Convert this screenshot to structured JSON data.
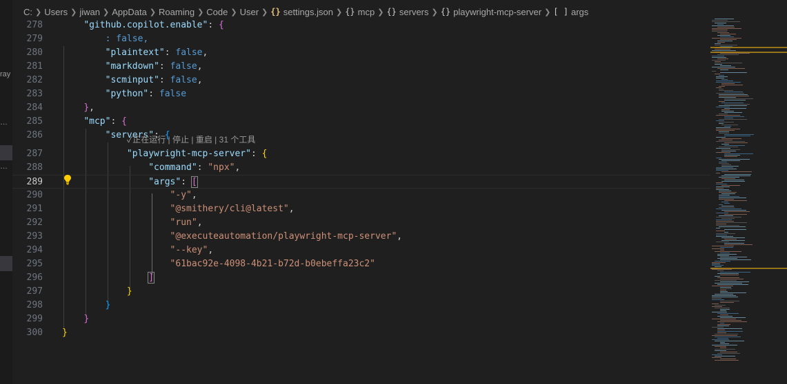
{
  "breadcrumb": {
    "items": [
      {
        "label": "C:",
        "icon": ""
      },
      {
        "label": "Users",
        "icon": ""
      },
      {
        "label": "jiwan",
        "icon": ""
      },
      {
        "label": "AppData",
        "icon": ""
      },
      {
        "label": "Roaming",
        "icon": ""
      },
      {
        "label": "Code",
        "icon": ""
      },
      {
        "label": "User",
        "icon": ""
      },
      {
        "label": "settings.json",
        "icon": "json-braces-icon"
      },
      {
        "label": "mcp",
        "icon": "object-braces-icon"
      },
      {
        "label": "servers",
        "icon": "object-braces-icon"
      },
      {
        "label": "playwright-mcp-server",
        "icon": "object-braces-icon"
      },
      {
        "label": "args",
        "icon": "array-brackets-icon"
      }
    ]
  },
  "sidebar_fragments": [
    "ray",
    "…",
    "…"
  ],
  "editor": {
    "active_line": "289",
    "lines": [
      {
        "n": "278",
        "html": "    <span class=\"k\">\"github.copilot.enable\"</span><span class=\"p\">: </span><span class=\"br2\">{</span>"
      },
      {
        "n": "279",
        "html": "        <span class=\"b\">: false,</span>"
      },
      {
        "n": "280",
        "html": "        <span class=\"k\">\"plaintext\"</span><span class=\"p\">: </span><span class=\"b\">false</span><span class=\"p\">,</span>"
      },
      {
        "n": "281",
        "html": "        <span class=\"k\">\"markdown\"</span><span class=\"p\">: </span><span class=\"b\">false</span><span class=\"p\">,</span>"
      },
      {
        "n": "282",
        "html": "        <span class=\"k\">\"scminput\"</span><span class=\"p\">: </span><span class=\"b\">false</span><span class=\"p\">,</span>"
      },
      {
        "n": "283",
        "html": "        <span class=\"k\">\"python\"</span><span class=\"p\">: </span><span class=\"b\">false</span>"
      },
      {
        "n": "284",
        "html": "    <span class=\"br2\">}</span><span class=\"p\">,</span>"
      },
      {
        "n": "285",
        "html": "    <span class=\"k\">\"mcp\"</span><span class=\"p\">: </span><span class=\"br2\">{</span>"
      },
      {
        "n": "286",
        "html": "        <span class=\"k\">\"servers\"</span><span class=\"p\">: </span><span class=\"br3\">{</span>"
      },
      {
        "n": "287",
        "html": "            <span class=\"k\">\"playwright-mcp-server\"</span><span class=\"p\">: </span><span class=\"br1\">{</span>"
      },
      {
        "n": "288",
        "html": "                <span class=\"k\">\"command\"</span><span class=\"p\">: </span><span class=\"s\">\"npx\"</span><span class=\"p\">,</span>"
      },
      {
        "n": "289",
        "html": "                <span class=\"k\">\"args\"</span><span class=\"p\">: </span><span class=\"br2 hl\">[</span>"
      },
      {
        "n": "290",
        "html": "                    <span class=\"s\">\"-y\"</span><span class=\"p\">,</span>"
      },
      {
        "n": "291",
        "html": "                    <span class=\"s\">\"@smithery/cli@latest\"</span><span class=\"p\">,</span>"
      },
      {
        "n": "292",
        "html": "                    <span class=\"s\">\"run\"</span><span class=\"p\">,</span>"
      },
      {
        "n": "293",
        "html": "                    <span class=\"s\">\"@executeautomation/playwright-mcp-server\"</span><span class=\"p\">,</span>"
      },
      {
        "n": "294",
        "html": "                    <span class=\"s\">\"--key\"</span><span class=\"p\">,</span>"
      },
      {
        "n": "295",
        "html": "                    <span class=\"s\">\"61bac92e-4098-4b21-b72d-b0ebeffa23c2\"</span>"
      },
      {
        "n": "296",
        "html": "                <span class=\"br2 hl\">]</span>"
      },
      {
        "n": "297",
        "html": "            <span class=\"br1\">}</span>"
      },
      {
        "n": "298",
        "html": "        <span class=\"br3\">}</span>"
      },
      {
        "n": "299",
        "html": "    <span class=\"br2\">}</span>"
      },
      {
        "n": "300",
        "html": "<span class=\"br1\">}</span>"
      }
    ]
  },
  "codelens": {
    "check": "✓",
    "running": "正在运行",
    "stop": "停止",
    "restart": "重启",
    "tools": "31 个工具"
  },
  "colors": {
    "background": "#1f1f1f",
    "key": "#9cdcfe",
    "string": "#ce9178",
    "keyword": "#569cd6",
    "bracket_gold": "#ffd700",
    "bracket_pink": "#da70d6",
    "bracket_blue": "#179fff"
  }
}
